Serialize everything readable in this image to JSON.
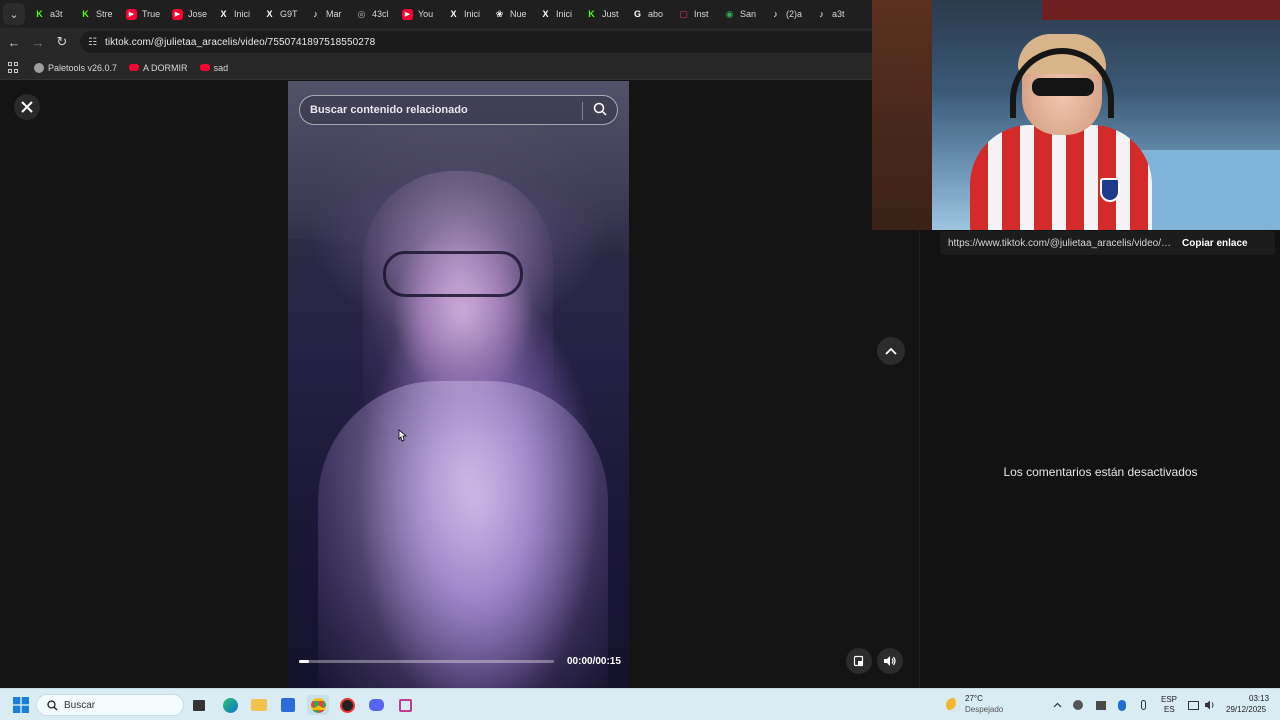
{
  "tabs": [
    {
      "label": "a3t",
      "icon": "k-green-icon",
      "color": "#53fc18"
    },
    {
      "label": "Stre",
      "icon": "k-green-icon",
      "color": "#53fc18"
    },
    {
      "label": "True",
      "icon": "youtube-icon",
      "color": "#ff0033"
    },
    {
      "label": "Jose",
      "icon": "youtube-icon",
      "color": "#ff0033"
    },
    {
      "label": "Inici",
      "icon": "x-icon",
      "color": "#ffffff"
    },
    {
      "label": "G9T",
      "icon": "x-icon",
      "color": "#ffffff"
    },
    {
      "label": "Mar",
      "icon": "tiktok-icon",
      "color": "#ffffff"
    },
    {
      "label": "43cl",
      "icon": "globe-icon",
      "color": "#bbbbbb"
    },
    {
      "label": "You",
      "icon": "youtube-icon",
      "color": "#ff0033"
    },
    {
      "label": "Inici",
      "icon": "x-icon",
      "color": "#ffffff"
    },
    {
      "label": "Nue",
      "icon": "openai-icon",
      "color": "#ffffff"
    },
    {
      "label": "Inici",
      "icon": "x-icon",
      "color": "#ffffff"
    },
    {
      "label": "Just",
      "icon": "k-green-icon",
      "color": "#53fc18"
    },
    {
      "label": "abo",
      "icon": "google-icon",
      "color": "#ffffff"
    },
    {
      "label": "Inst",
      "icon": "instagram-icon",
      "color": "#e1306c"
    },
    {
      "label": "San",
      "icon": "maps-icon",
      "color": "#34a853"
    },
    {
      "label": "(2)a",
      "icon": "tiktok-icon",
      "color": "#ffffff"
    },
    {
      "label": "a3t",
      "icon": "tiktok-icon",
      "color": "#ffffff"
    }
  ],
  "address_bar": {
    "url": "tiktok.com/@julietaa_aracelis/video/7550741897518550278"
  },
  "bookmarks": [
    {
      "label": "Paletools v26.0.7",
      "color": "#9e9e9e"
    },
    {
      "label": "A DORMIR",
      "color": "#ff0033"
    },
    {
      "label": "sad",
      "color": "#ff0033"
    }
  ],
  "video": {
    "search_placeholder": "Buscar contenido relacionado",
    "time": "00:00/00:15",
    "progress": 0.04
  },
  "side_panel": {
    "link": "https://www.tiktok.com/@julietaa_aracelis/video/7...",
    "copy_label": "Copiar enlace",
    "comments_text": "Los comentarios están desactivados"
  },
  "taskbar": {
    "search_label": "Buscar",
    "weather_temp": "27°C",
    "weather_desc": "Despejado",
    "lang_top": "ESP",
    "lang_bottom": "ES",
    "time": "03:13",
    "date": "29/12/2025"
  }
}
